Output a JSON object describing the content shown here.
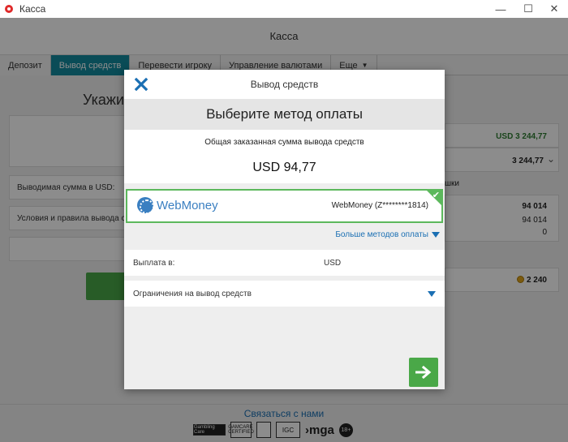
{
  "window": {
    "title": "Касса",
    "min_glyph": "—",
    "max_glyph": "☐",
    "close_glyph": "✕"
  },
  "header": {
    "title": "Касса"
  },
  "tabs": [
    {
      "label": "Депозит"
    },
    {
      "label": "Вывод средств",
      "active": true
    },
    {
      "label": "Перевести игроку"
    },
    {
      "label": "Управление валютами"
    },
    {
      "label": "Еще",
      "caret": "▼"
    }
  ],
  "background": {
    "heading": "Укажит",
    "withdraw_amount_label": "Выводимая сумма в USD:",
    "terms_label": "Условия и правила вывода сре",
    "right": {
      "balance": "USD 3 244,77",
      "balance2": "3 244,77",
      "partial_label": "шки",
      "num1": "94 014",
      "num2": "94 014",
      "num3": "0",
      "coins": "2 240",
      "caret": "⌄"
    }
  },
  "modal": {
    "header_title": "Вывод средств",
    "section_title": "Выберите метод оплаты",
    "total_label": "Общая заказанная сумма вывода средств",
    "total_value": "USD 94,77",
    "method": {
      "brand": "WebMoney",
      "account": "WebMoney (Z********1814)",
      "check": "✔"
    },
    "more_methods": "Больше методов оплаты",
    "payout_label": "Выплата в:",
    "payout_value": "USD",
    "limits_label": "Ограничения на вывод средств"
  },
  "footer": {
    "contact": "Связаться с нами",
    "logos": {
      "gambling": "Gambling Care",
      "gamcare": "GAMCARE CERTIFIED",
      "igc": "IGC",
      "mga": "›mga",
      "age": "18+"
    }
  },
  "colors": {
    "accent_tab": "#138a9e",
    "success_green": "#4aa848",
    "link_blue": "#1a6fb3"
  }
}
